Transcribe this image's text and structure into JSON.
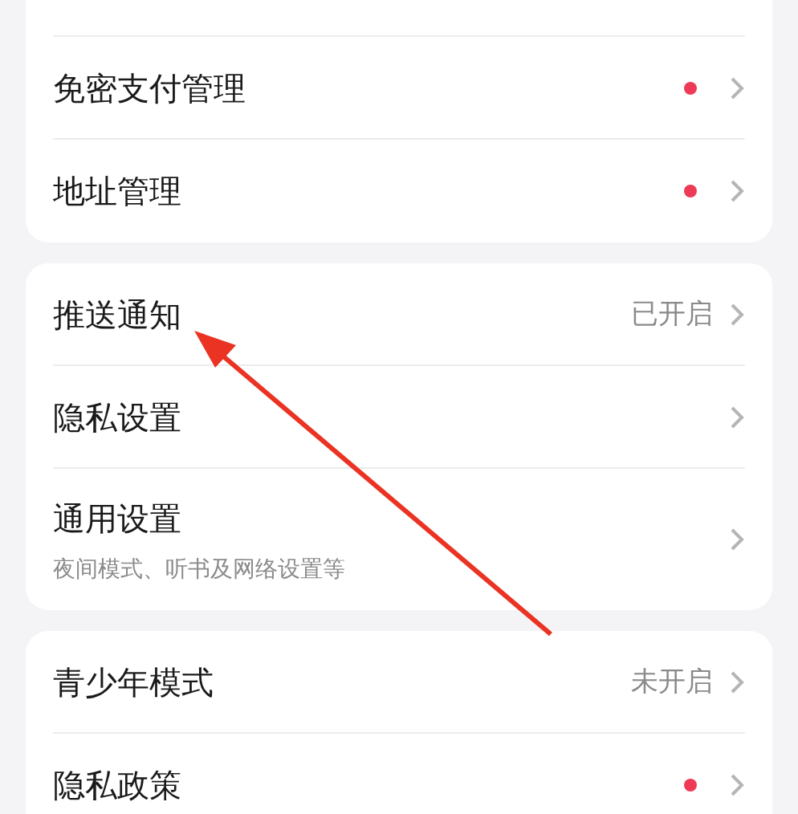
{
  "sections": [
    {
      "continues_above": true,
      "items": [
        {
          "label": "免密支付管理",
          "dot": true
        },
        {
          "label": "地址管理",
          "dot": true
        }
      ]
    },
    {
      "continues_above": false,
      "items": [
        {
          "label": "推送通知",
          "value": "已开启",
          "dot": false
        },
        {
          "label": "隐私设置",
          "dot": false
        },
        {
          "label": "通用设置",
          "subtitle": "夜间模式、听书及网络设置等",
          "dot": false
        }
      ]
    },
    {
      "continues_above": false,
      "items": [
        {
          "label": "青少年模式",
          "value": "未开启",
          "dot": false
        },
        {
          "label": "隐私政策",
          "dot": true
        }
      ]
    }
  ]
}
